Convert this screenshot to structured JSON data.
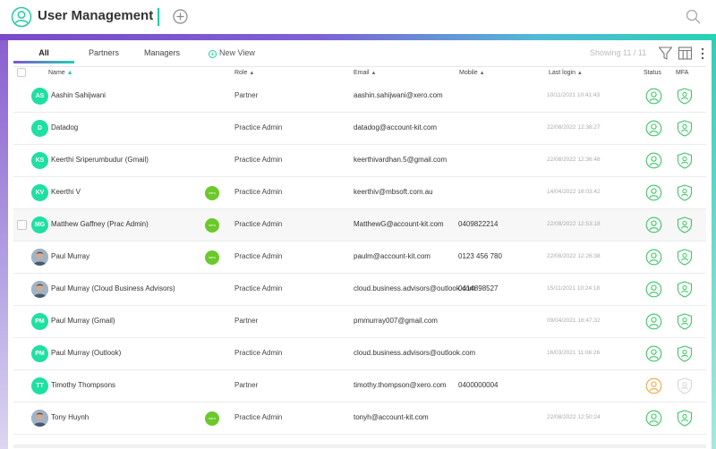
{
  "header": {
    "title": "User Management",
    "logo_icon": "user-circle-icon",
    "add_icon": "plus-circle-icon",
    "search_icon": "search-icon"
  },
  "colors": {
    "accent": "#1fcca1",
    "gradient_start": "#7a49c9",
    "gradient_end": "#28d2b4",
    "xero_badge": "#6bc92b",
    "status_active": "#3cc466",
    "status_pending": "#f0a742",
    "mfa_disabled": "#d6d6d6"
  },
  "tabs": [
    {
      "label": "All",
      "active": true
    },
    {
      "label": "Partners",
      "active": false
    },
    {
      "label": "Managers",
      "active": false
    }
  ],
  "new_view_label": "New View",
  "showing_label": "Showing 11 / 11",
  "toolbar_icons": [
    "filter-icon",
    "columns-icon",
    "more-vertical-icon"
  ],
  "columns": {
    "name": "Name",
    "role": "Role",
    "email": "Email",
    "mobile": "Mobile",
    "last_login": "Last login",
    "status": "Status",
    "mfa": "MFA"
  },
  "rows": [
    {
      "initials": "AS",
      "photo": false,
      "name": "Aashin Sahijwani",
      "xero": false,
      "role": "Partner",
      "email": "aashin.sahijwani@xero.com",
      "mobile": "",
      "last_login": "10/11/2021 10:41:43",
      "status": "active",
      "mfa": "enabled"
    },
    {
      "initials": "D",
      "photo": false,
      "name": "Datadog",
      "xero": false,
      "role": "Practice Admin",
      "email": "datadog@account-kit.com",
      "mobile": "",
      "last_login": "22/08/2022 12:38:27",
      "status": "active",
      "mfa": "enabled"
    },
    {
      "initials": "KS",
      "photo": false,
      "name": "Keerthi Sriperumbudur (Gmail)",
      "xero": false,
      "role": "Practice Admin",
      "email": "keerthivardhan.5@gmail.com",
      "mobile": "",
      "last_login": "22/08/2022 12:36:48",
      "status": "active",
      "mfa": "enabled"
    },
    {
      "initials": "KV",
      "photo": false,
      "name": "Keerthi V",
      "xero": true,
      "role": "Practice Admin",
      "email": "keerthiv@mbsoft.com.au",
      "mobile": "",
      "last_login": "14/04/2022 16:03:42",
      "status": "active",
      "mfa": "enabled"
    },
    {
      "initials": "MG",
      "photo": false,
      "name": "Matthew Gaffney (Prac Admin)",
      "xero": true,
      "role": "Practice Admin",
      "email": "MatthewG@account-kit.com",
      "mobile": "0409822214",
      "last_login": "22/08/2022 12:53:18",
      "status": "active",
      "mfa": "enabled",
      "hover": true
    },
    {
      "initials": "",
      "photo": true,
      "name": "Paul Murray",
      "xero": true,
      "role": "Practice Admin",
      "email": "paulm@account-kit.com",
      "mobile": "0123 456 780",
      "last_login": "22/08/2022 12:26:38",
      "status": "active",
      "mfa": "enabled"
    },
    {
      "initials": "",
      "photo": true,
      "name": "Paul Murray (Cloud Business Advisors)",
      "xero": false,
      "role": "Practice Admin",
      "email": "cloud.business.advisors@outlook.com",
      "mobile": "0414898527",
      "last_login": "15/11/2021 10:24:18",
      "status": "active",
      "mfa": "enabled"
    },
    {
      "initials": "PM",
      "photo": false,
      "name": "Paul Murray (Gmail)",
      "xero": false,
      "role": "Partner",
      "email": "pmmurray007@gmail.com",
      "mobile": "",
      "last_login": "09/04/2021 16:47:32",
      "status": "active",
      "mfa": "enabled"
    },
    {
      "initials": "PM",
      "photo": false,
      "name": "Paul Murray (Outlook)",
      "xero": false,
      "role": "Practice Admin",
      "email": "cloud.business.advisors@outlook.com",
      "mobile": "",
      "last_login": "16/03/2021 11:06:26",
      "status": "active",
      "mfa": "enabled"
    },
    {
      "initials": "TT",
      "photo": false,
      "name": "Timothy Thompsons",
      "xero": false,
      "role": "Partner",
      "email": "timothy.thompson@xero.com",
      "mobile": "0400000004",
      "last_login": "",
      "status": "pending",
      "mfa": "disabled"
    },
    {
      "initials": "",
      "photo": true,
      "name": "Tony Huynh",
      "xero": true,
      "role": "Practice Admin",
      "email": "tonyh@account-kit.com",
      "mobile": "",
      "last_login": "22/08/2022 12:50:24",
      "status": "active",
      "mfa": "enabled"
    }
  ],
  "xero_badge_label": "xero"
}
